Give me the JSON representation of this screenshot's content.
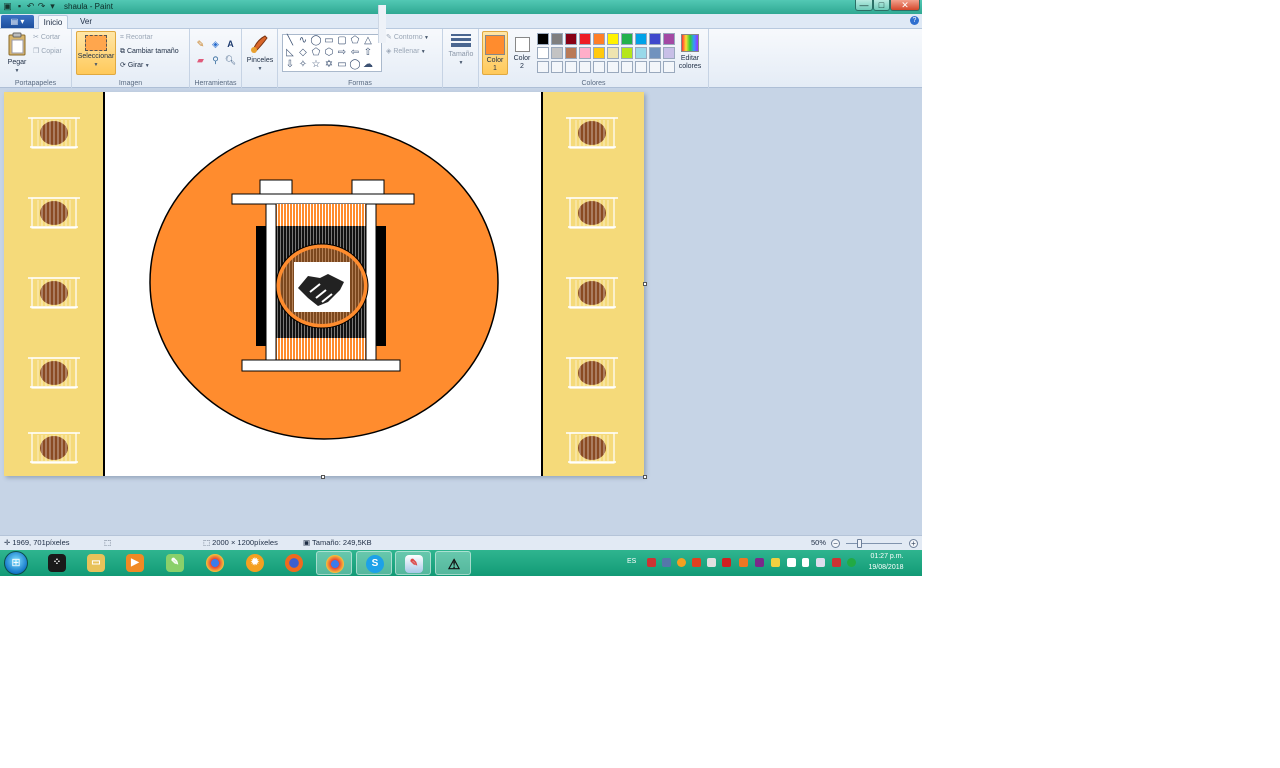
{
  "window": {
    "title": "shaula - Paint",
    "minimize": "—",
    "maximize": "□",
    "close": "✕"
  },
  "tabs": {
    "file": "▤ ▾",
    "inicio": "Inicio",
    "ver": "Ver"
  },
  "ribbon": {
    "portapapeles": {
      "label": "Portapapeles",
      "pegar": "Pegar",
      "cortar": "Cortar",
      "copiar": "Copiar"
    },
    "imagen": {
      "label": "Imagen",
      "seleccionar": "Seleccionar",
      "recortar": "Recortar",
      "cambiar_tamano": "Cambiar tamaño",
      "girar": "Girar"
    },
    "herramientas": {
      "label": "Herramientas",
      "text_tool": "A"
    },
    "pinceles": {
      "label": "Pinceles"
    },
    "formas": {
      "label": "Formas",
      "contorno": "Contorno",
      "rellenar": "Rellenar"
    },
    "tamano": {
      "label": "Tamaño"
    },
    "colores": {
      "label": "Colores",
      "color1_line1": "Color",
      "color1_line2": "1",
      "color2_line1": "Color",
      "color2_line2": "2",
      "editar_line1": "Editar",
      "editar_line2": "colores",
      "color1": "#ff8c2e",
      "color2": "#ffffff",
      "palette_row1": [
        "#000000",
        "#7f7f7f",
        "#880015",
        "#ed1c24",
        "#ff7f27",
        "#fff200",
        "#22b14c",
        "#00a2e8",
        "#3f48cc",
        "#a349a4"
      ],
      "palette_row2": [
        "#ffffff",
        "#c3c3c3",
        "#b97a57",
        "#ffaec9",
        "#ffc90e",
        "#efe4b0",
        "#b5e61d",
        "#99d9ea",
        "#7092be",
        "#c8bfe7"
      ]
    }
  },
  "status": {
    "cursor": "1969, 701píxeles",
    "dimensions": "2000 × 1200píxeles",
    "size": "Tamaño: 249,5KB",
    "zoom": "50%",
    "zoom_minus": "−",
    "zoom_plus": "+"
  },
  "taskbar": {
    "language": "ES",
    "time": "01:27 p.m.",
    "date": "19/08/2018"
  },
  "colors": {
    "orange": "#ff8c2e",
    "panel_yellow": "#f5da7a",
    "taskbar": "#129a76"
  }
}
